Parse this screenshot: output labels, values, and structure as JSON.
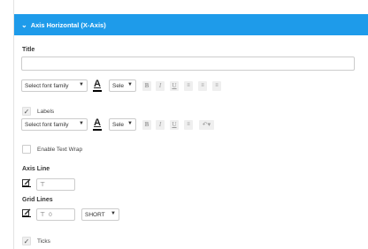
{
  "header": {
    "title": "Axis Horizontal (X-Axis)",
    "chevron": "chevron-down-icon"
  },
  "title_section": {
    "label": "Title",
    "input_value": "",
    "font_family_select": "Select font family",
    "font_size_select": "Sele"
  },
  "labels_section": {
    "checkbox_label": "Labels",
    "checked": true,
    "font_family_select": "Select font family",
    "font_size_select": "Sele"
  },
  "text_wrap": {
    "label": "Enable Text Wrap",
    "checked": false
  },
  "axis_line": {
    "label": "Axis Line",
    "thickness_value": ""
  },
  "grid_lines": {
    "label": "Grid Lines",
    "thickness_value": "0",
    "style_select": "SHORT"
  },
  "ticks": {
    "label": "Ticks",
    "checked": true
  },
  "icons": {
    "color_a": "font-color-icon",
    "bold": "bold-icon",
    "italic": "italic-icon",
    "underline": "underline-icon",
    "align_left": "align-left-icon",
    "align_center": "align-center-icon",
    "align_right": "align-right-icon",
    "rotate": "rotate-icon",
    "edit": "edit-color-icon",
    "thickness": "line-thickness-icon"
  },
  "colors": {
    "header_bg": "#1e9bea",
    "disabled_btn": "#efefef"
  }
}
